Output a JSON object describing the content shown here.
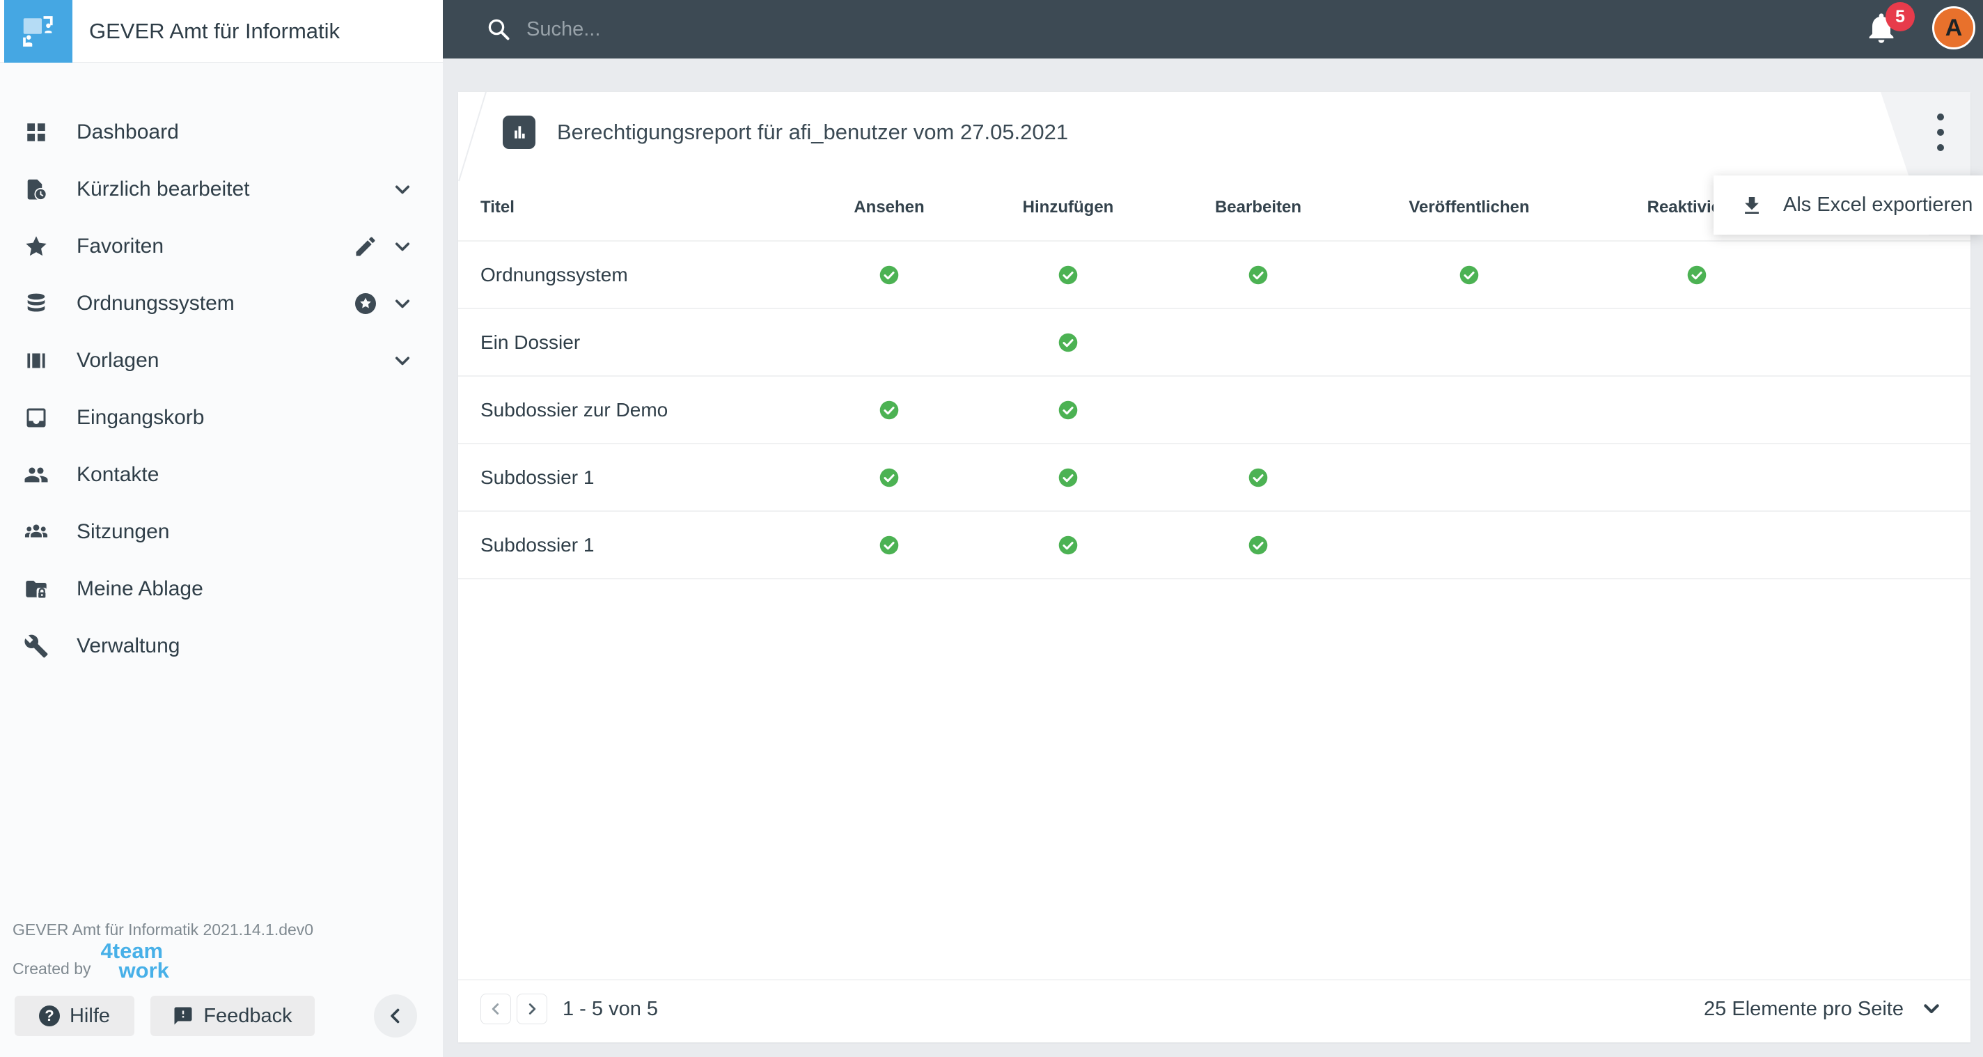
{
  "app": {
    "title": "GEVER Amt für Informatik"
  },
  "topbar": {
    "search_placeholder": "Suche...",
    "notification_count": "5",
    "avatar_initial": "A"
  },
  "sidebar": {
    "items": [
      {
        "label": "Dashboard",
        "icon": "dashboard-grid-icon",
        "extras": []
      },
      {
        "label": "Kürzlich bearbeitet",
        "icon": "recent-document-icon",
        "extras": [
          "chevron-down"
        ]
      },
      {
        "label": "Favoriten",
        "icon": "star-icon",
        "extras": [
          "pencil",
          "chevron-down"
        ]
      },
      {
        "label": "Ordnungssystem",
        "icon": "database-icon",
        "extras": [
          "star-circle",
          "chevron-down"
        ]
      },
      {
        "label": "Vorlagen",
        "icon": "templates-icon",
        "extras": [
          "chevron-down"
        ]
      },
      {
        "label": "Eingangskorb",
        "icon": "inbox-icon",
        "extras": []
      },
      {
        "label": "Kontakte",
        "icon": "contacts-icon",
        "extras": []
      },
      {
        "label": "Sitzungen",
        "icon": "meetings-icon",
        "extras": []
      },
      {
        "label": "Meine Ablage",
        "icon": "private-folder-icon",
        "extras": []
      },
      {
        "label": "Verwaltung",
        "icon": "wrench-icon",
        "extras": []
      }
    ],
    "version": "GEVER Amt für Informatik 2021.14.1.dev0",
    "created_by_label": "Created by",
    "brand_line1": "4team",
    "brand_line2": "work",
    "help_label": "Hilfe",
    "feedback_label": "Feedback"
  },
  "report": {
    "title": "Berechtigungsreport für afi_benutzer vom 27.05.2021"
  },
  "menu": {
    "export_label": "Als Excel exportieren"
  },
  "table": {
    "columns": [
      "Titel",
      "Ansehen",
      "Hinzufügen",
      "Bearbeiten",
      "Veröffentlichen",
      "Reaktivieren"
    ],
    "rows": [
      {
        "title": "Ordnungssystem",
        "permissions": [
          true,
          true,
          true,
          true,
          true
        ]
      },
      {
        "title": "Ein Dossier",
        "permissions": [
          false,
          true,
          false,
          false,
          false
        ]
      },
      {
        "title": "Subdossier zur Demo",
        "permissions": [
          true,
          true,
          false,
          false,
          false
        ]
      },
      {
        "title": "Subdossier 1",
        "permissions": [
          true,
          true,
          true,
          false,
          false
        ]
      },
      {
        "title": "Subdossier 1",
        "permissions": [
          true,
          true,
          true,
          false,
          false
        ]
      }
    ]
  },
  "pagination": {
    "range_label": "1 - 5 von 5",
    "per_page_label": "25 Elemente pro Seite"
  },
  "colors": {
    "topbar": "#3d4a54",
    "logo_blue": "#45a7e3",
    "check_green": "#4cb253",
    "badge_red": "#e73b4b",
    "avatar_orange": "#e8712c",
    "brand_blue": "#47b0e8"
  }
}
